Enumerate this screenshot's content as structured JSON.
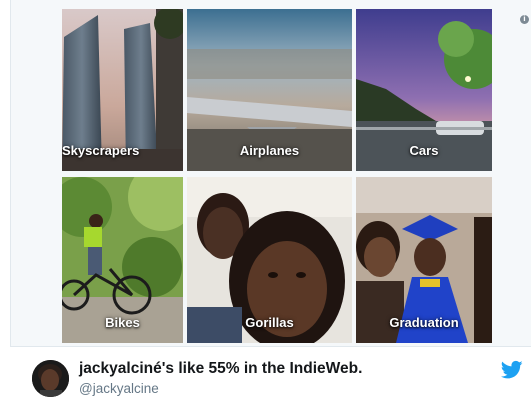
{
  "gallery": {
    "tiles": [
      {
        "label": "Skyscrapers"
      },
      {
        "label": "Airplanes"
      },
      {
        "label": "Cars"
      },
      {
        "label": "Bikes"
      },
      {
        "label": "Gorillas"
      },
      {
        "label": "Graduation"
      }
    ]
  },
  "tweet": {
    "name": "jackyalciné's like 55% in the IndieWeb.",
    "handle": "@jackyalcine"
  },
  "icons": {
    "info": "info-icon",
    "bird": "twitter-bird-icon",
    "info_glyph": "i"
  },
  "colors": {
    "twitter_blue": "#1da1f2",
    "handle_gray": "#657786"
  }
}
